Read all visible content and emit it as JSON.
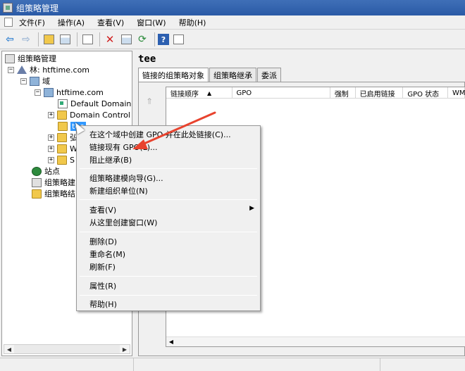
{
  "window": {
    "title": "组策略管理"
  },
  "menu": [
    "文件(F)",
    "操作(A)",
    "查看(V)",
    "窗口(W)",
    "帮助(H)"
  ],
  "tree": {
    "root": "组策略管理",
    "forest": "林: htftime.com",
    "domains": "域",
    "domain": "htftime.com",
    "items": [
      "Default Domain",
      "Domain Control",
      "tee"
    ],
    "hidden_children": [
      "弘",
      "W",
      "S"
    ],
    "sites": "站点",
    "modeling": "组策略建",
    "results": "组策略结"
  },
  "right": {
    "title": "tee",
    "tabs": [
      "链接的组策略对象",
      "组策略继承",
      "委派"
    ],
    "columns": [
      "链接顺序",
      "GPO",
      "强制",
      "已启用链接",
      "GPO 状态",
      "WM"
    ]
  },
  "context_menu": {
    "items": [
      "在这个域中创建 GPO 并在此处链接(C)...",
      "链接现有 GPO(L)...",
      "阻止继承(B)",
      "组策略建模向导(G)...",
      "新建组织单位(N)",
      "查看(V)",
      "从这里创建窗口(W)",
      "删除(D)",
      "重命名(M)",
      "刷新(F)",
      "属性(R)",
      "帮助(H)"
    ]
  },
  "colors": {
    "title_bar": "#2a5aa6",
    "selection": "#3399ff",
    "annotation_arrow": "#e8432e"
  }
}
